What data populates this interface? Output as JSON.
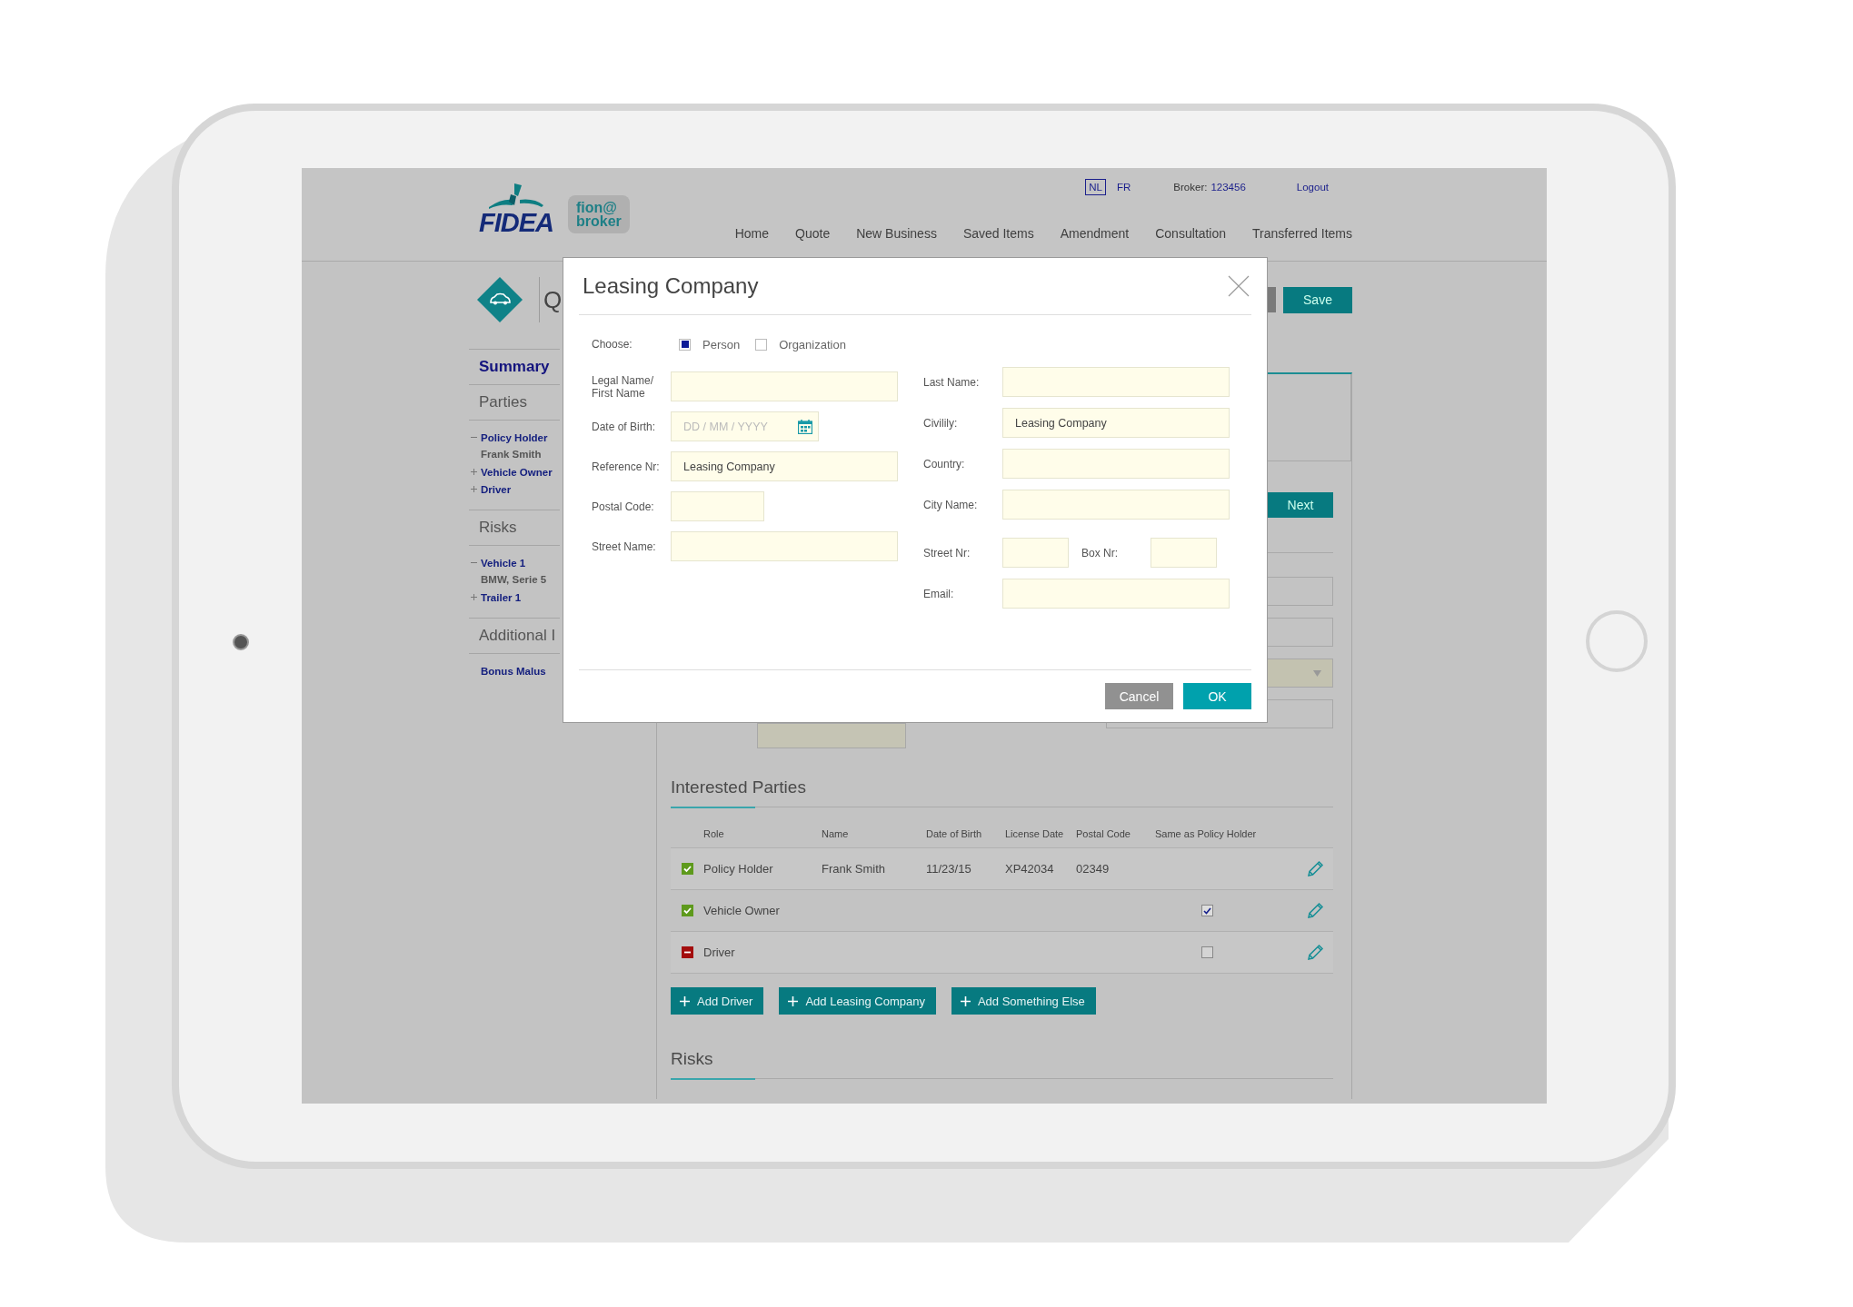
{
  "header": {
    "logo_text": "FIDEA",
    "badge_lines": [
      "fion@",
      "broker"
    ],
    "languages": [
      {
        "label": "NL",
        "selected": true
      },
      {
        "label": "FR",
        "selected": false
      }
    ],
    "broker_label": "Broker:",
    "broker_id": "123456",
    "logout": "Logout",
    "nav": [
      "Home",
      "Quote",
      "New Business",
      "Saved Items",
      "Amendment",
      "Consultation",
      "Transferred Items"
    ]
  },
  "page": {
    "title": "Q",
    "save": "Save",
    "next": "Next"
  },
  "sidebar": [
    {
      "title": "Summary",
      "selected": true
    },
    {
      "title": "Parties",
      "selected": false,
      "items": [
        {
          "label": "Policy Holder",
          "expanded": true,
          "children": [
            {
              "label": "Frank Smith"
            }
          ]
        },
        {
          "label": "Vehicle Owner",
          "expanded": false
        },
        {
          "label": "Driver",
          "expanded": false
        }
      ]
    },
    {
      "title": "Risks",
      "selected": false,
      "items": [
        {
          "label": "Vehicle 1",
          "expanded": true,
          "children": [
            {
              "label": "BMW, Serie 5"
            }
          ]
        },
        {
          "label": "Trailer 1",
          "expanded": false
        }
      ]
    },
    {
      "title": "Additional I",
      "selected": false,
      "items": [
        {
          "label": "Bonus Malus"
        }
      ]
    }
  ],
  "interested_parties": {
    "title": "Interested Parties",
    "columns": [
      "Role",
      "Name",
      "Date of Birth",
      "License Date",
      "Postal Code",
      "Same as Policy Holder"
    ],
    "rows": [
      {
        "complete": true,
        "role": "Policy Holder",
        "name": "Frank Smith",
        "date_of_birth": "11/23/15",
        "license_date": "XP42034",
        "postal_code": "02349"
      },
      {
        "complete": true,
        "role": "Vehicle Owner",
        "same_as_policy_holder": true
      },
      {
        "complete": false,
        "role": "Driver",
        "same_as_policy_holder": false
      }
    ],
    "buttons": [
      "Add Driver",
      "Add Leasing Company",
      "Add Something Else"
    ]
  },
  "risks": {
    "title": "Risks"
  },
  "modal": {
    "title": "Leasing Company",
    "choose_label": "Choose:",
    "options": [
      {
        "label": "Person",
        "selected": true
      },
      {
        "label": "Organization",
        "selected": false
      }
    ],
    "left_fields": [
      {
        "kind": "text",
        "label": "Legal Name/\nFirst Name"
      },
      {
        "kind": "date",
        "label": "Date of Birth:",
        "placeholder": "DD / MM / YYYY"
      },
      {
        "kind": "text",
        "label": "Reference Nr:",
        "value": "Leasing Company"
      },
      {
        "kind": "code",
        "label": "Postal Code:"
      },
      {
        "kind": "text",
        "label": "Street Name:"
      }
    ],
    "right_fields": [
      {
        "kind": "text",
        "label": "Last Name:"
      },
      {
        "kind": "text",
        "label": "Civilily:",
        "value": "Leasing Company"
      },
      {
        "kind": "text",
        "label": "Country:"
      },
      {
        "kind": "text",
        "label": "City Name:"
      },
      {
        "kind": "pair",
        "fields": [
          {
            "label": "Street Nr:"
          },
          {
            "label": "Box Nr:"
          }
        ]
      },
      {
        "kind": "text",
        "label": "Email:"
      }
    ],
    "cancel": "Cancel",
    "ok": "OK"
  }
}
